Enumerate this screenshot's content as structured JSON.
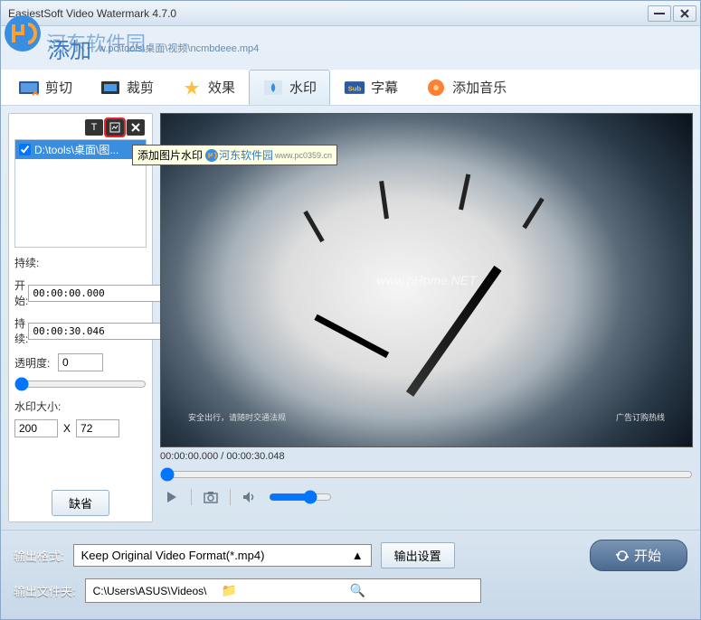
{
  "window": {
    "title": "EasiestSoft Video Watermark 4.7.0"
  },
  "header": {
    "add_label": "添加",
    "file_path": "w.pc\\tools\\桌面\\视频\\ncmbdeee.mp4",
    "brand_overlay": "河东软件园"
  },
  "tabs": [
    {
      "id": "cut",
      "label": "剪切"
    },
    {
      "id": "crop",
      "label": "裁剪"
    },
    {
      "id": "effect",
      "label": "效果"
    },
    {
      "id": "watermark",
      "label": "水印",
      "active": true
    },
    {
      "id": "subtitle",
      "label": "字幕"
    },
    {
      "id": "music",
      "label": "添加音乐"
    }
  ],
  "tooltip": {
    "text": "添加图片水印",
    "brand": "河东软件园",
    "brand_sub": "www.pc0359.cn"
  },
  "left": {
    "file_item": "D:\\tools\\桌面\\图...",
    "duration_label": "持续:",
    "start_label": "开始:",
    "start_value": "00:00:00.000",
    "end_label": "持续:",
    "end_value": "00:00:30.046",
    "opacity_label": "透明度:",
    "opacity_value": "0",
    "size_label": "水印大小:",
    "size_w": "200",
    "size_x": "X",
    "size_h": "72",
    "default_btn": "缺省"
  },
  "preview": {
    "watermark_text": "www.pHome.NET",
    "sub_left": "安全出行，请随时交通法规",
    "sub_right": "广告订购热线"
  },
  "playback": {
    "time_display": "00:00:00.000 / 00:00:30.048"
  },
  "bottom": {
    "format_label": "输出格式:",
    "format_value": "Keep Original Video Format(*.mp4)",
    "settings_btn": "输出设置",
    "start_btn": "开始",
    "folder_label": "输出文件夹:",
    "folder_value": "C:\\Users\\ASUS\\Videos\\"
  }
}
